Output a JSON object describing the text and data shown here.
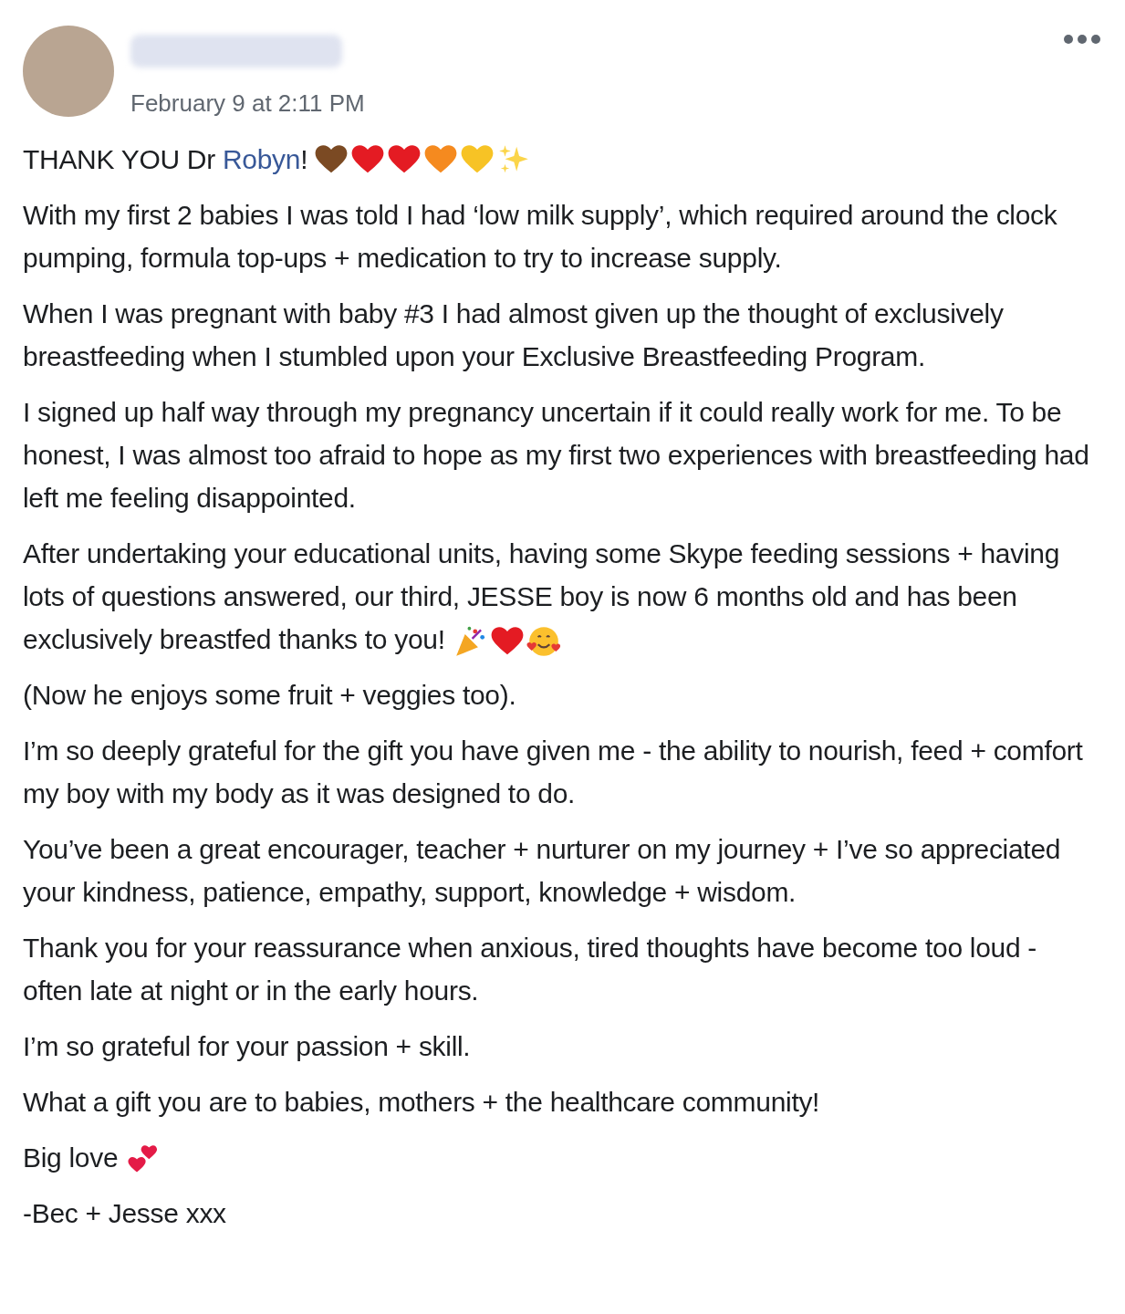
{
  "post": {
    "author_hidden": true,
    "timestamp": "February 9 at 2:11 PM"
  },
  "greeting": {
    "before": "THANK YOU Dr ",
    "link": "Robyn",
    "after": "!",
    "emojis": [
      {
        "kind": "heart",
        "color": "#7b4a23"
      },
      {
        "kind": "heart",
        "color": "#e41b23"
      },
      {
        "kind": "heart",
        "color": "#e41b23"
      },
      {
        "kind": "heart",
        "color": "#f58a1f"
      },
      {
        "kind": "heart",
        "color": "#f7c325"
      },
      {
        "kind": "sparkles",
        "color": "#fbd54a"
      }
    ]
  },
  "paragraphs": [
    {
      "text": "With my first 2 babies I was told I had ‘low milk supply’, which required around the clock pumping, formula top-ups + medication to try to increase supply."
    },
    {
      "text": "When I was pregnant with baby #3 I had almost given up the thought of exclusively breastfeeding when I stumbled upon your Exclusive Breastfeeding Program."
    },
    {
      "text": "I signed up half way through my pregnancy uncertain if it could really work for me. To be honest, I was almost too afraid to hope as my first two experiences with breastfeeding had left me feeling disappointed."
    },
    {
      "text": "After undertaking your educational units, having some Skype feeding sessions + having lots of questions answered, our third, JESSE boy is now 6 months old and has been exclusively breastfed thanks to you!",
      "emojis": [
        {
          "kind": "party-popper",
          "color": "#f4a623"
        },
        {
          "kind": "heart",
          "color": "#e41b23"
        },
        {
          "kind": "smiling-face-with-hearts",
          "color": "#fbc02d"
        }
      ]
    },
    {
      "text": "(Now he enjoys some fruit + veggies too)."
    },
    {
      "text": "I’m so deeply grateful for the gift you have given me - the ability to nourish, feed + comfort my boy with my body as it was designed to do."
    },
    {
      "text": "You’ve been a great encourager, teacher + nurturer on my journey + I’ve so appreciated your kindness, patience, empathy, support, knowledge + wisdom."
    },
    {
      "text": "Thank you for your reassurance when anxious, tired thoughts have become too loud - often late at night or in the early hours."
    },
    {
      "text": "I’m so grateful for your passion + skill."
    },
    {
      "text": "What a gift you are to babies, mothers + the healthcare community!"
    },
    {
      "text": "Big love",
      "emojis": [
        {
          "kind": "two-hearts",
          "color": "#e41b47"
        }
      ]
    },
    {
      "text": "-Bec + Jesse xxx"
    }
  ]
}
